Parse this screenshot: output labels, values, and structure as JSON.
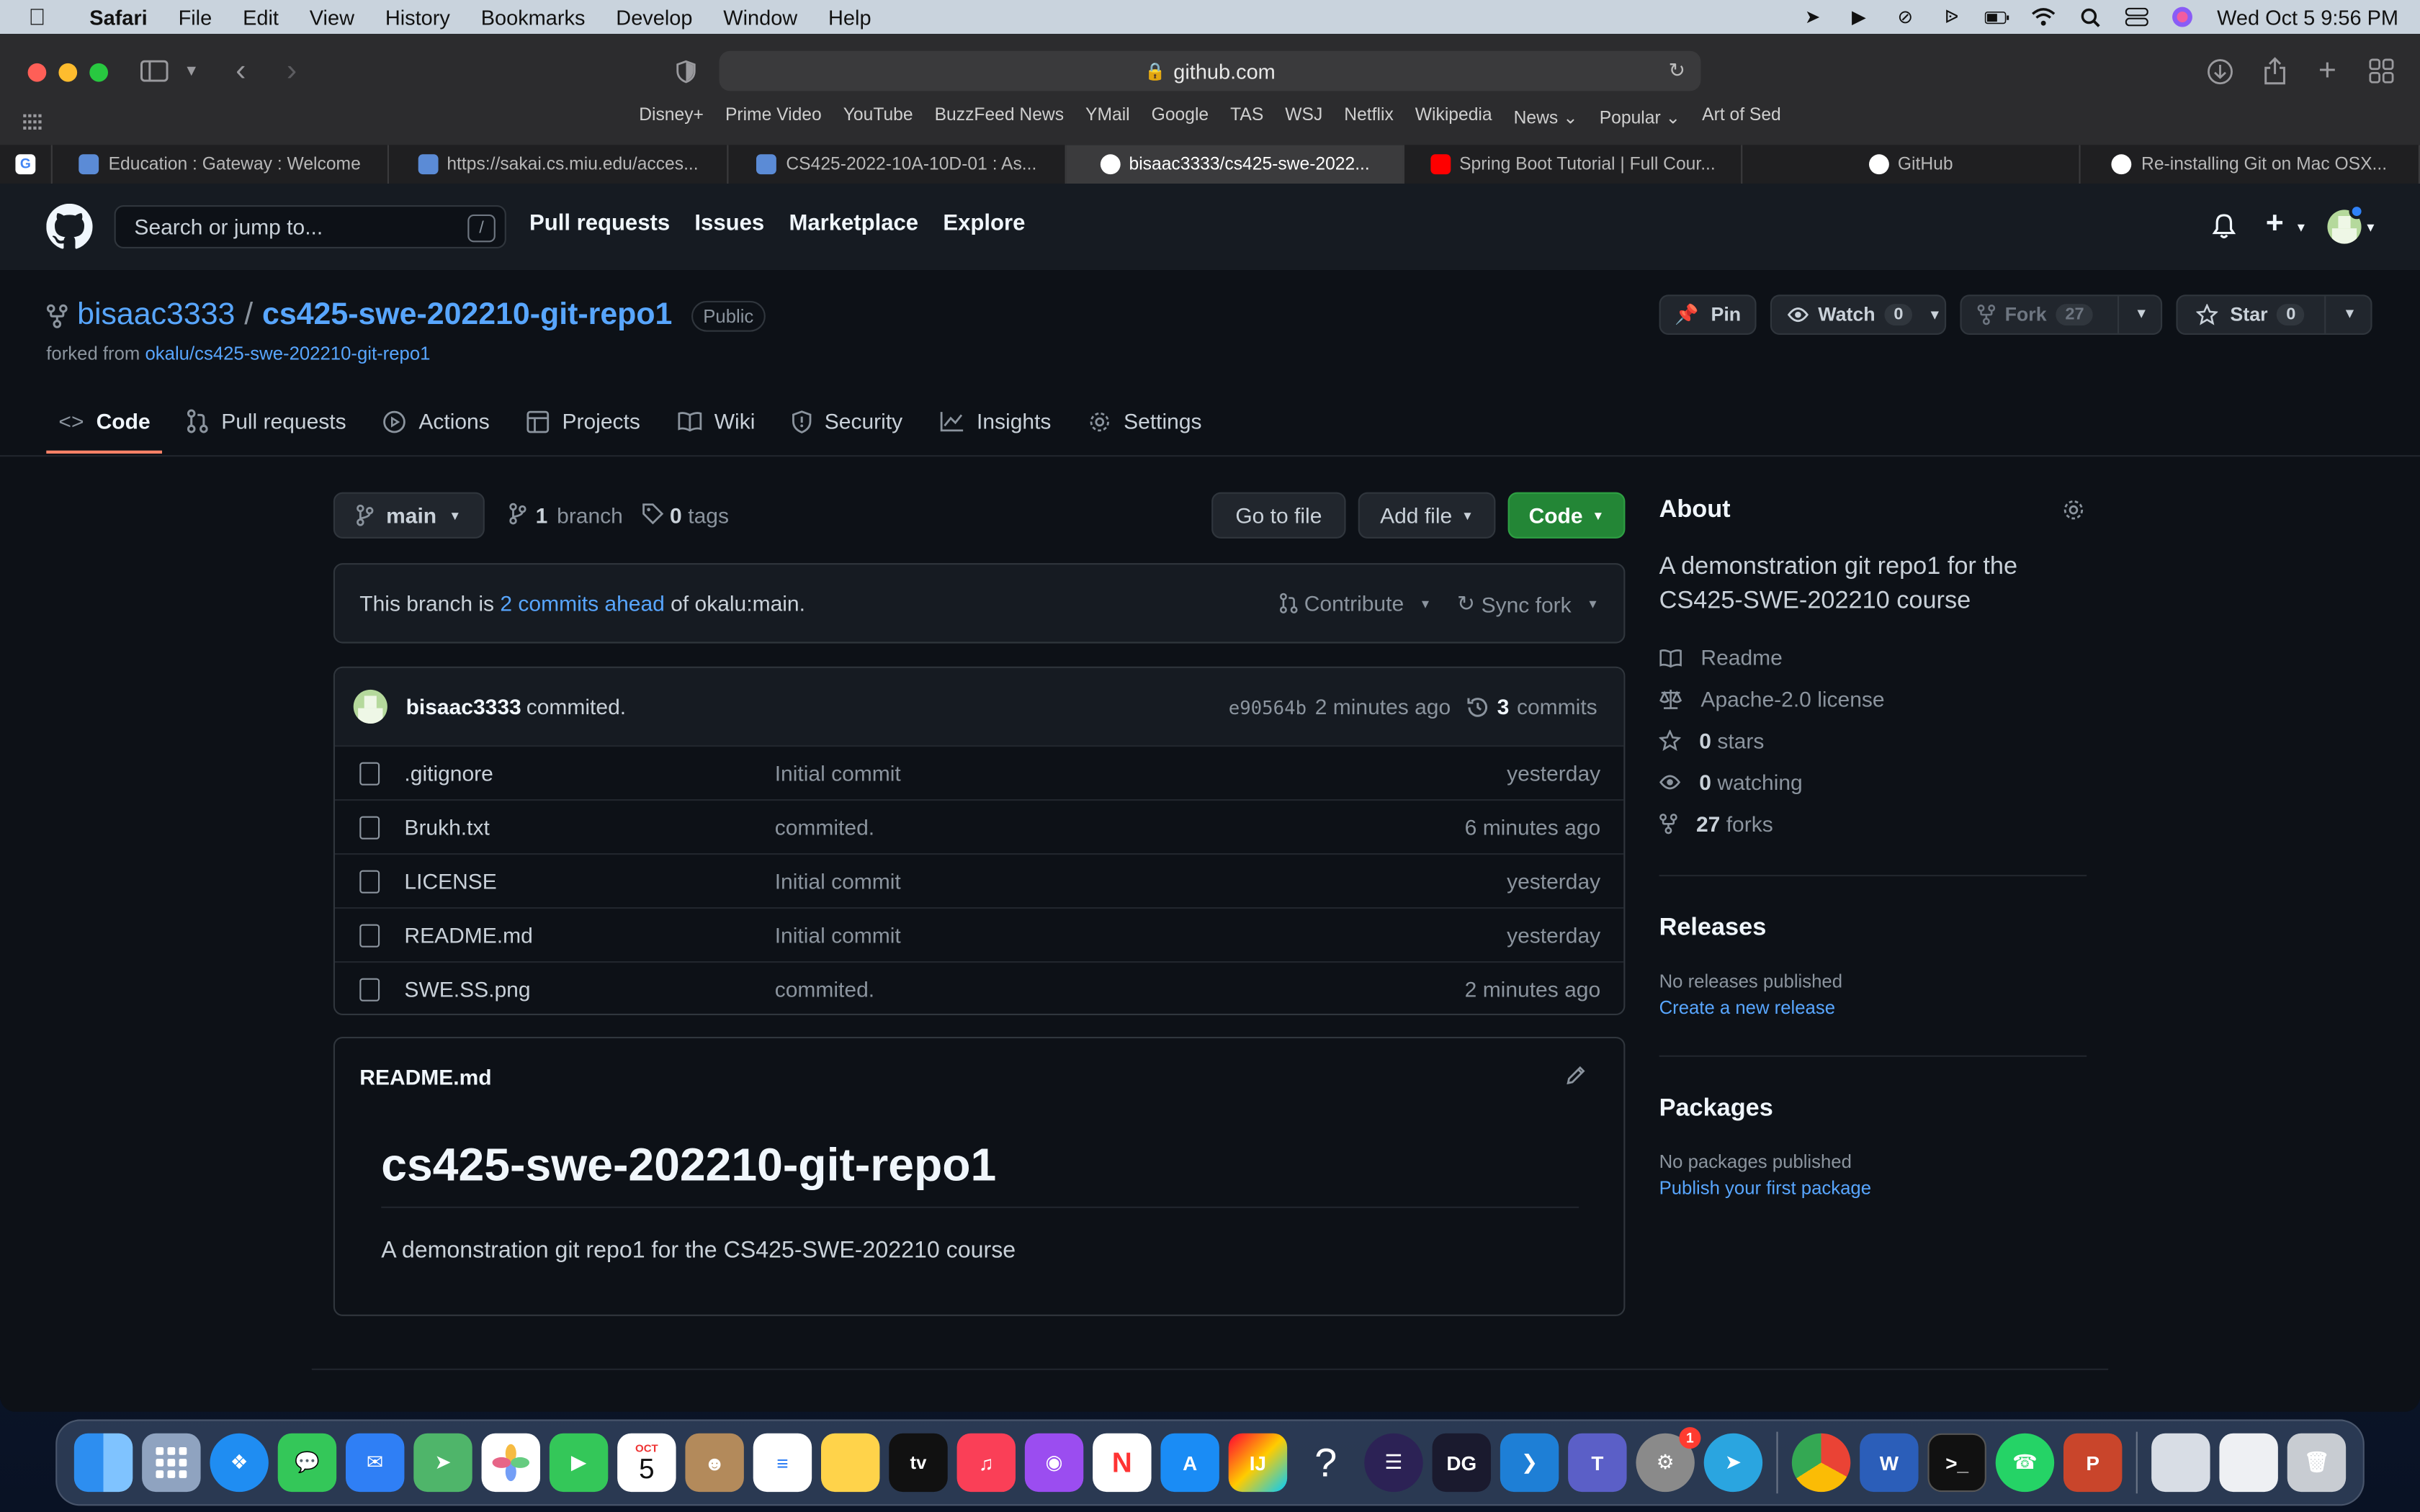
{
  "menubar": {
    "app": "Safari",
    "items": [
      "File",
      "Edit",
      "View",
      "History",
      "Bookmarks",
      "Develop",
      "Window",
      "Help"
    ],
    "datetime": "Wed Oct 5  9:56 PM"
  },
  "browser": {
    "url": "github.com",
    "favorites": [
      "Disney+",
      "Prime Video",
      "YouTube",
      "BuzzFeed News",
      "YMail",
      "Google",
      "TAS",
      "WSJ",
      "Netflix",
      "Wikipedia",
      "News ⌄",
      "Popular ⌄",
      "Art of Sed"
    ],
    "tabs": [
      {
        "label": "Education : Gateway : Welcome"
      },
      {
        "label": "https://sakai.cs.miu.edu/acces..."
      },
      {
        "label": "CS425-2022-10A-10D-01 : As..."
      },
      {
        "label": "bisaac3333/cs425-swe-2022..."
      },
      {
        "label": "Spring Boot Tutorial | Full Cour..."
      },
      {
        "label": "GitHub"
      },
      {
        "label": "Re-installing Git on Mac OSX..."
      }
    ]
  },
  "github": {
    "search_placeholder": "Search or jump to...",
    "slash": "/",
    "nav": [
      "Pull requests",
      "Issues",
      "Marketplace",
      "Explore"
    ],
    "repo": {
      "owner": "bisaac3333",
      "sep": "/",
      "name": "cs425-swe-202210-git-repo1",
      "visibility": "Public",
      "forked_prefix": "forked from",
      "forked_from": "okalu/cs425-swe-202210-git-repo1"
    },
    "actions": {
      "pin": "Pin",
      "watch": "Watch",
      "watch_count": "0",
      "fork": "Fork",
      "fork_count": "27",
      "star": "Star",
      "star_count": "0"
    },
    "repo_nav": [
      "Code",
      "Pull requests",
      "Actions",
      "Projects",
      "Wiki",
      "Security",
      "Insights",
      "Settings"
    ],
    "branch": "main",
    "branches_count": "1",
    "branches_label": "branch",
    "tags_count": "0",
    "tags_label": "tags",
    "go_to_file": "Go to file",
    "add_file": "Add file",
    "code_btn": "Code",
    "ahead": {
      "prefix": "This branch is",
      "link": "2 commits ahead",
      "suffix": "of okalu:main.",
      "contribute": "Contribute",
      "sync": "Sync fork"
    },
    "commit": {
      "author": "bisaac3333",
      "message": "commited.",
      "sha": "e90564b",
      "time": "2 minutes ago",
      "count": "3",
      "count_label": "commits"
    },
    "files": [
      {
        "name": ".gitignore",
        "message": "Initial commit",
        "time": "yesterday"
      },
      {
        "name": "Brukh.txt",
        "message": "commited.",
        "time": "6 minutes ago"
      },
      {
        "name": "LICENSE",
        "message": "Initial commit",
        "time": "yesterday"
      },
      {
        "name": "README.md",
        "message": "Initial commit",
        "time": "yesterday"
      },
      {
        "name": "SWE.SS.png",
        "message": "commited.",
        "time": "2 minutes ago"
      }
    ],
    "readme": {
      "filename": "README.md",
      "title": "cs425-swe-202210-git-repo1",
      "body": "A demonstration git repo1 for the CS425-SWE-202210 course"
    },
    "about": {
      "heading": "About",
      "description": "A demonstration git repo1 for the CS425-SWE-202210 course",
      "readme": "Readme",
      "license": "Apache-2.0 license",
      "stars_count": "0",
      "stars_label": "stars",
      "watching_count": "0",
      "watching_label": "watching",
      "forks_count": "27",
      "forks_label": "forks"
    },
    "releases": {
      "heading": "Releases",
      "none": "No releases published",
      "link": "Create a new release"
    },
    "packages": {
      "heading": "Packages",
      "none": "No packages published",
      "link": "Publish your first package"
    }
  },
  "dock": {
    "calendar_month": "OCT",
    "calendar_day": "5",
    "notification_badge": "1"
  }
}
